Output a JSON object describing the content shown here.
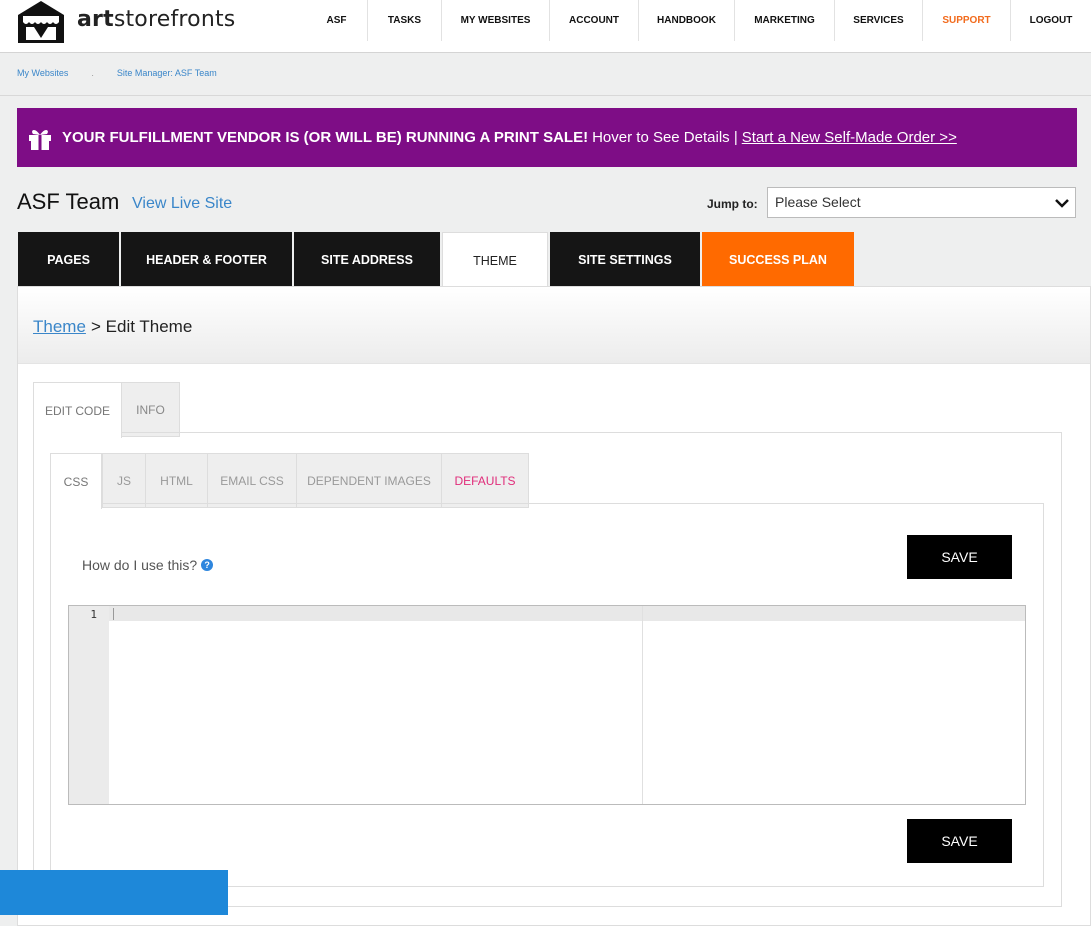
{
  "brand": {
    "name_bold": "art",
    "name_rest": "storefronts",
    "logo_icon": "storefront-awning-icon"
  },
  "nav": {
    "items": [
      {
        "label": "ASF"
      },
      {
        "label": "TASKS"
      },
      {
        "label": "MY WEBSITES"
      },
      {
        "label": "ACCOUNT"
      },
      {
        "label": "HANDBOOK"
      },
      {
        "label": "MARKETING"
      },
      {
        "label": "SERVICES"
      },
      {
        "label": "SUPPORT",
        "color": "#f26b1d"
      },
      {
        "label": "LOGOUT"
      }
    ]
  },
  "breadcrumb": {
    "items": [
      "My Websites",
      "Site Manager: ASF Team"
    ],
    "separator": "."
  },
  "banner": {
    "icon": "gift-icon",
    "bold_text": "YOUR FULFILLMENT VENDOR IS (OR WILL BE) RUNNING A PRINT SALE!",
    "text": "Hover to See Details |",
    "link_text": "Start a New Self-Made Order >>",
    "background": "#7e0d86"
  },
  "site": {
    "title": "ASF Team",
    "view_live": "View Live Site"
  },
  "jump": {
    "label": "Jump to:",
    "selected": "Please Select"
  },
  "tabs": {
    "items": [
      {
        "label": "PAGES"
      },
      {
        "label": "HEADER & FOOTER"
      },
      {
        "label": "SITE ADDRESS"
      },
      {
        "label": "THEME",
        "active": true
      },
      {
        "label": "SITE SETTINGS"
      },
      {
        "label": "SUCCESS PLAN",
        "color": "#ff6a00"
      }
    ]
  },
  "page": {
    "breadcrumb_link": "Theme",
    "breadcrumb_rest": "> Edit Theme"
  },
  "outer_tabs": [
    "EDIT CODE",
    "INFO"
  ],
  "inner_tabs": [
    "CSS",
    "JS",
    "HTML",
    "EMAIL CSS",
    "DEPENDENT IMAGES",
    "DEFAULTS"
  ],
  "help": {
    "text": "How do I use this?",
    "icon": "question-icon"
  },
  "buttons": {
    "save": "SAVE"
  },
  "editor": {
    "line_numbers": [
      "1"
    ],
    "content": ""
  }
}
